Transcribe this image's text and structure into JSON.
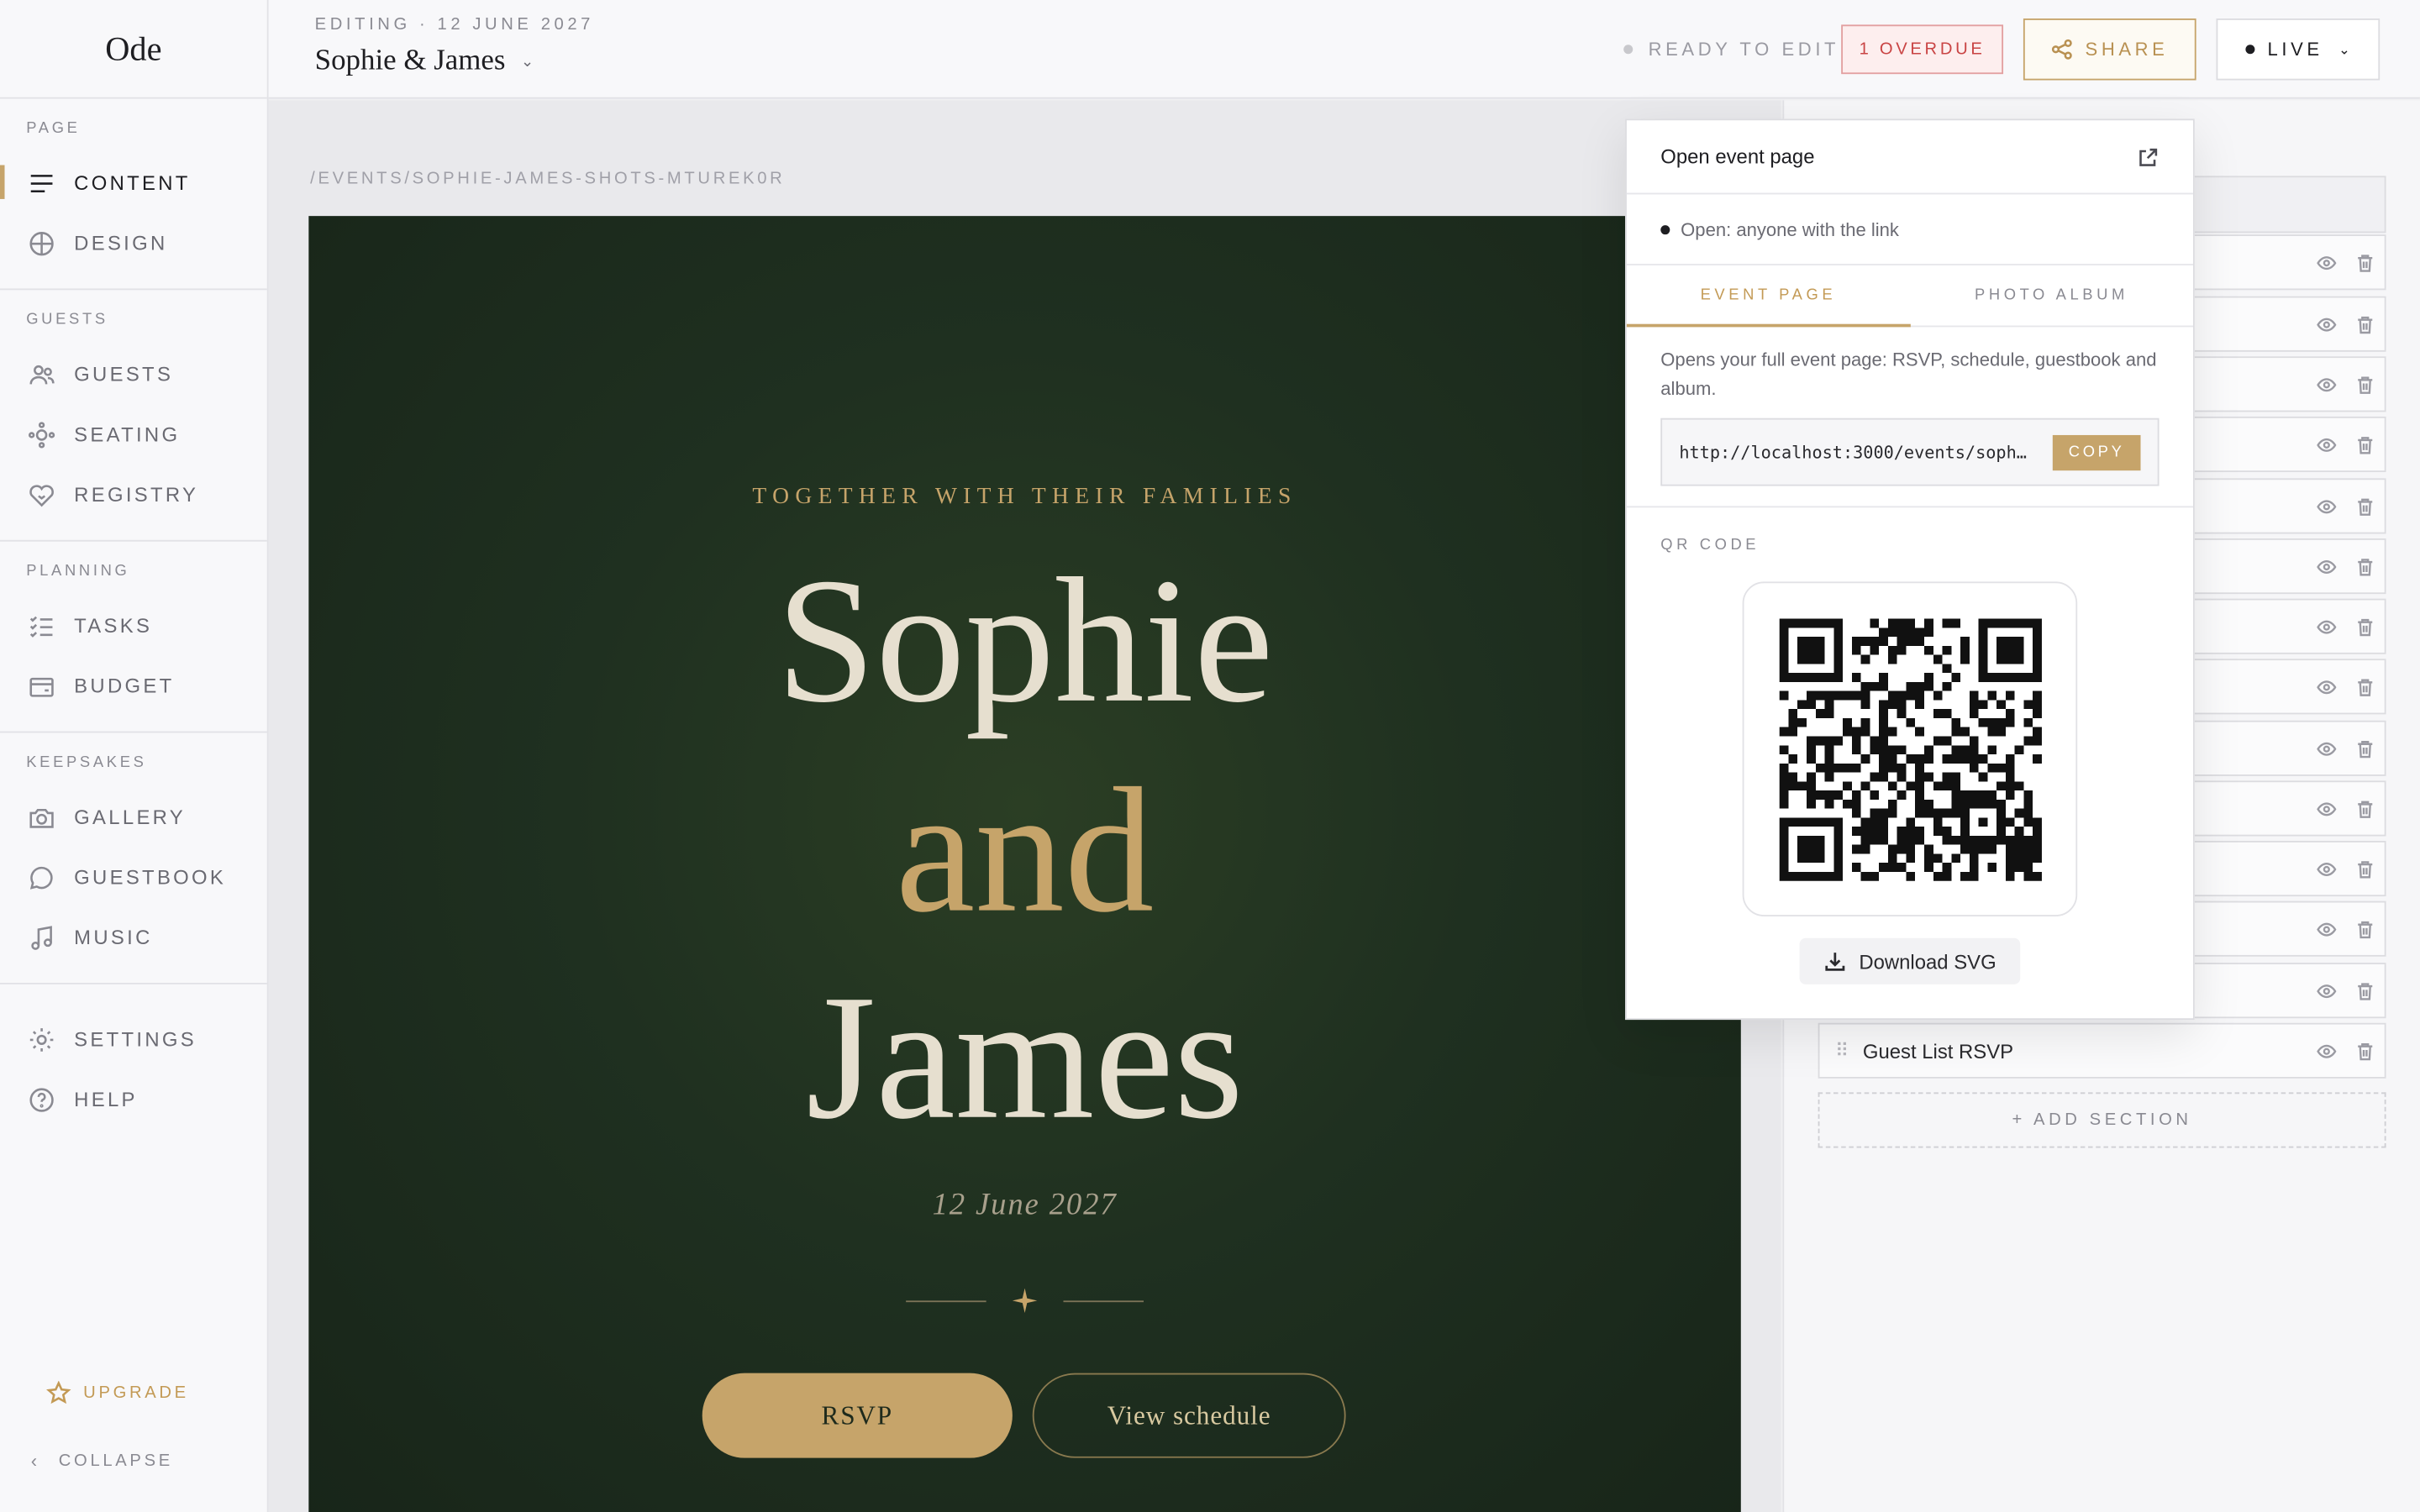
{
  "app": {
    "logo": "Ode"
  },
  "sidebar": {
    "sections": [
      {
        "heading": "PAGE",
        "items": [
          {
            "label": "CONTENT",
            "icon": "content-lines-icon",
            "active": true
          },
          {
            "label": "DESIGN",
            "icon": "globe-icon"
          }
        ]
      },
      {
        "heading": "GUESTS",
        "items": [
          {
            "label": "GUESTS",
            "icon": "people-icon"
          },
          {
            "label": "SEATING",
            "icon": "seating-icon"
          },
          {
            "label": "REGISTRY",
            "icon": "heart-gift-icon"
          }
        ]
      },
      {
        "heading": "PLANNING",
        "items": [
          {
            "label": "TASKS",
            "icon": "checklist-icon"
          },
          {
            "label": "BUDGET",
            "icon": "wallet-icon"
          }
        ]
      },
      {
        "heading": "KEEPSAKES",
        "items": [
          {
            "label": "GALLERY",
            "icon": "camera-icon"
          },
          {
            "label": "GUESTBOOK",
            "icon": "chat-bubble-icon"
          },
          {
            "label": "MUSIC",
            "icon": "music-note-icon"
          }
        ]
      }
    ],
    "bottom_items": [
      {
        "label": "SETTINGS",
        "icon": "sun-gear-icon"
      },
      {
        "label": "HELP",
        "icon": "help-circle-icon"
      }
    ],
    "upgrade_label": "UPGRADE",
    "collapse_label": "COLLAPSE"
  },
  "topbar": {
    "meta": "EDITING · 12 JUNE 2027",
    "title": "Sophie & James",
    "status": "READY TO EDIT",
    "overdue": "1 OVERDUE",
    "share": "SHARE",
    "live": "LIVE"
  },
  "main": {
    "slug": "/EVENTS/SOPHIE-JAMES-SHOTS-MTUREK0R",
    "hero": {
      "kicker": "TOGETHER WITH THEIR FAMILIES",
      "name1": "Sophie",
      "and": "and",
      "name2": "James",
      "date": "12 June 2027",
      "rsvp": "RSVP",
      "schedule": "View schedule"
    }
  },
  "sections_panel": {
    "visible_label": "Guest List RSVP",
    "add_label": "+ ADD SECTION"
  },
  "popover": {
    "title": "Open event page",
    "access": "Open: anyone with the link",
    "tabs": [
      "EVENT PAGE",
      "PHOTO ALBUM"
    ],
    "active_tab": 0,
    "description": "Opens your full event page: RSVP, schedule, guestbook and album.",
    "url": "http://localhost:3000/events/soph…",
    "copy": "COPY",
    "qr_label": "QR CODE",
    "download": "Download SVG"
  },
  "colors": {
    "accent_gold": "#c6a46a",
    "hero_green": "#1f3020",
    "overdue_red": "#c94444"
  }
}
